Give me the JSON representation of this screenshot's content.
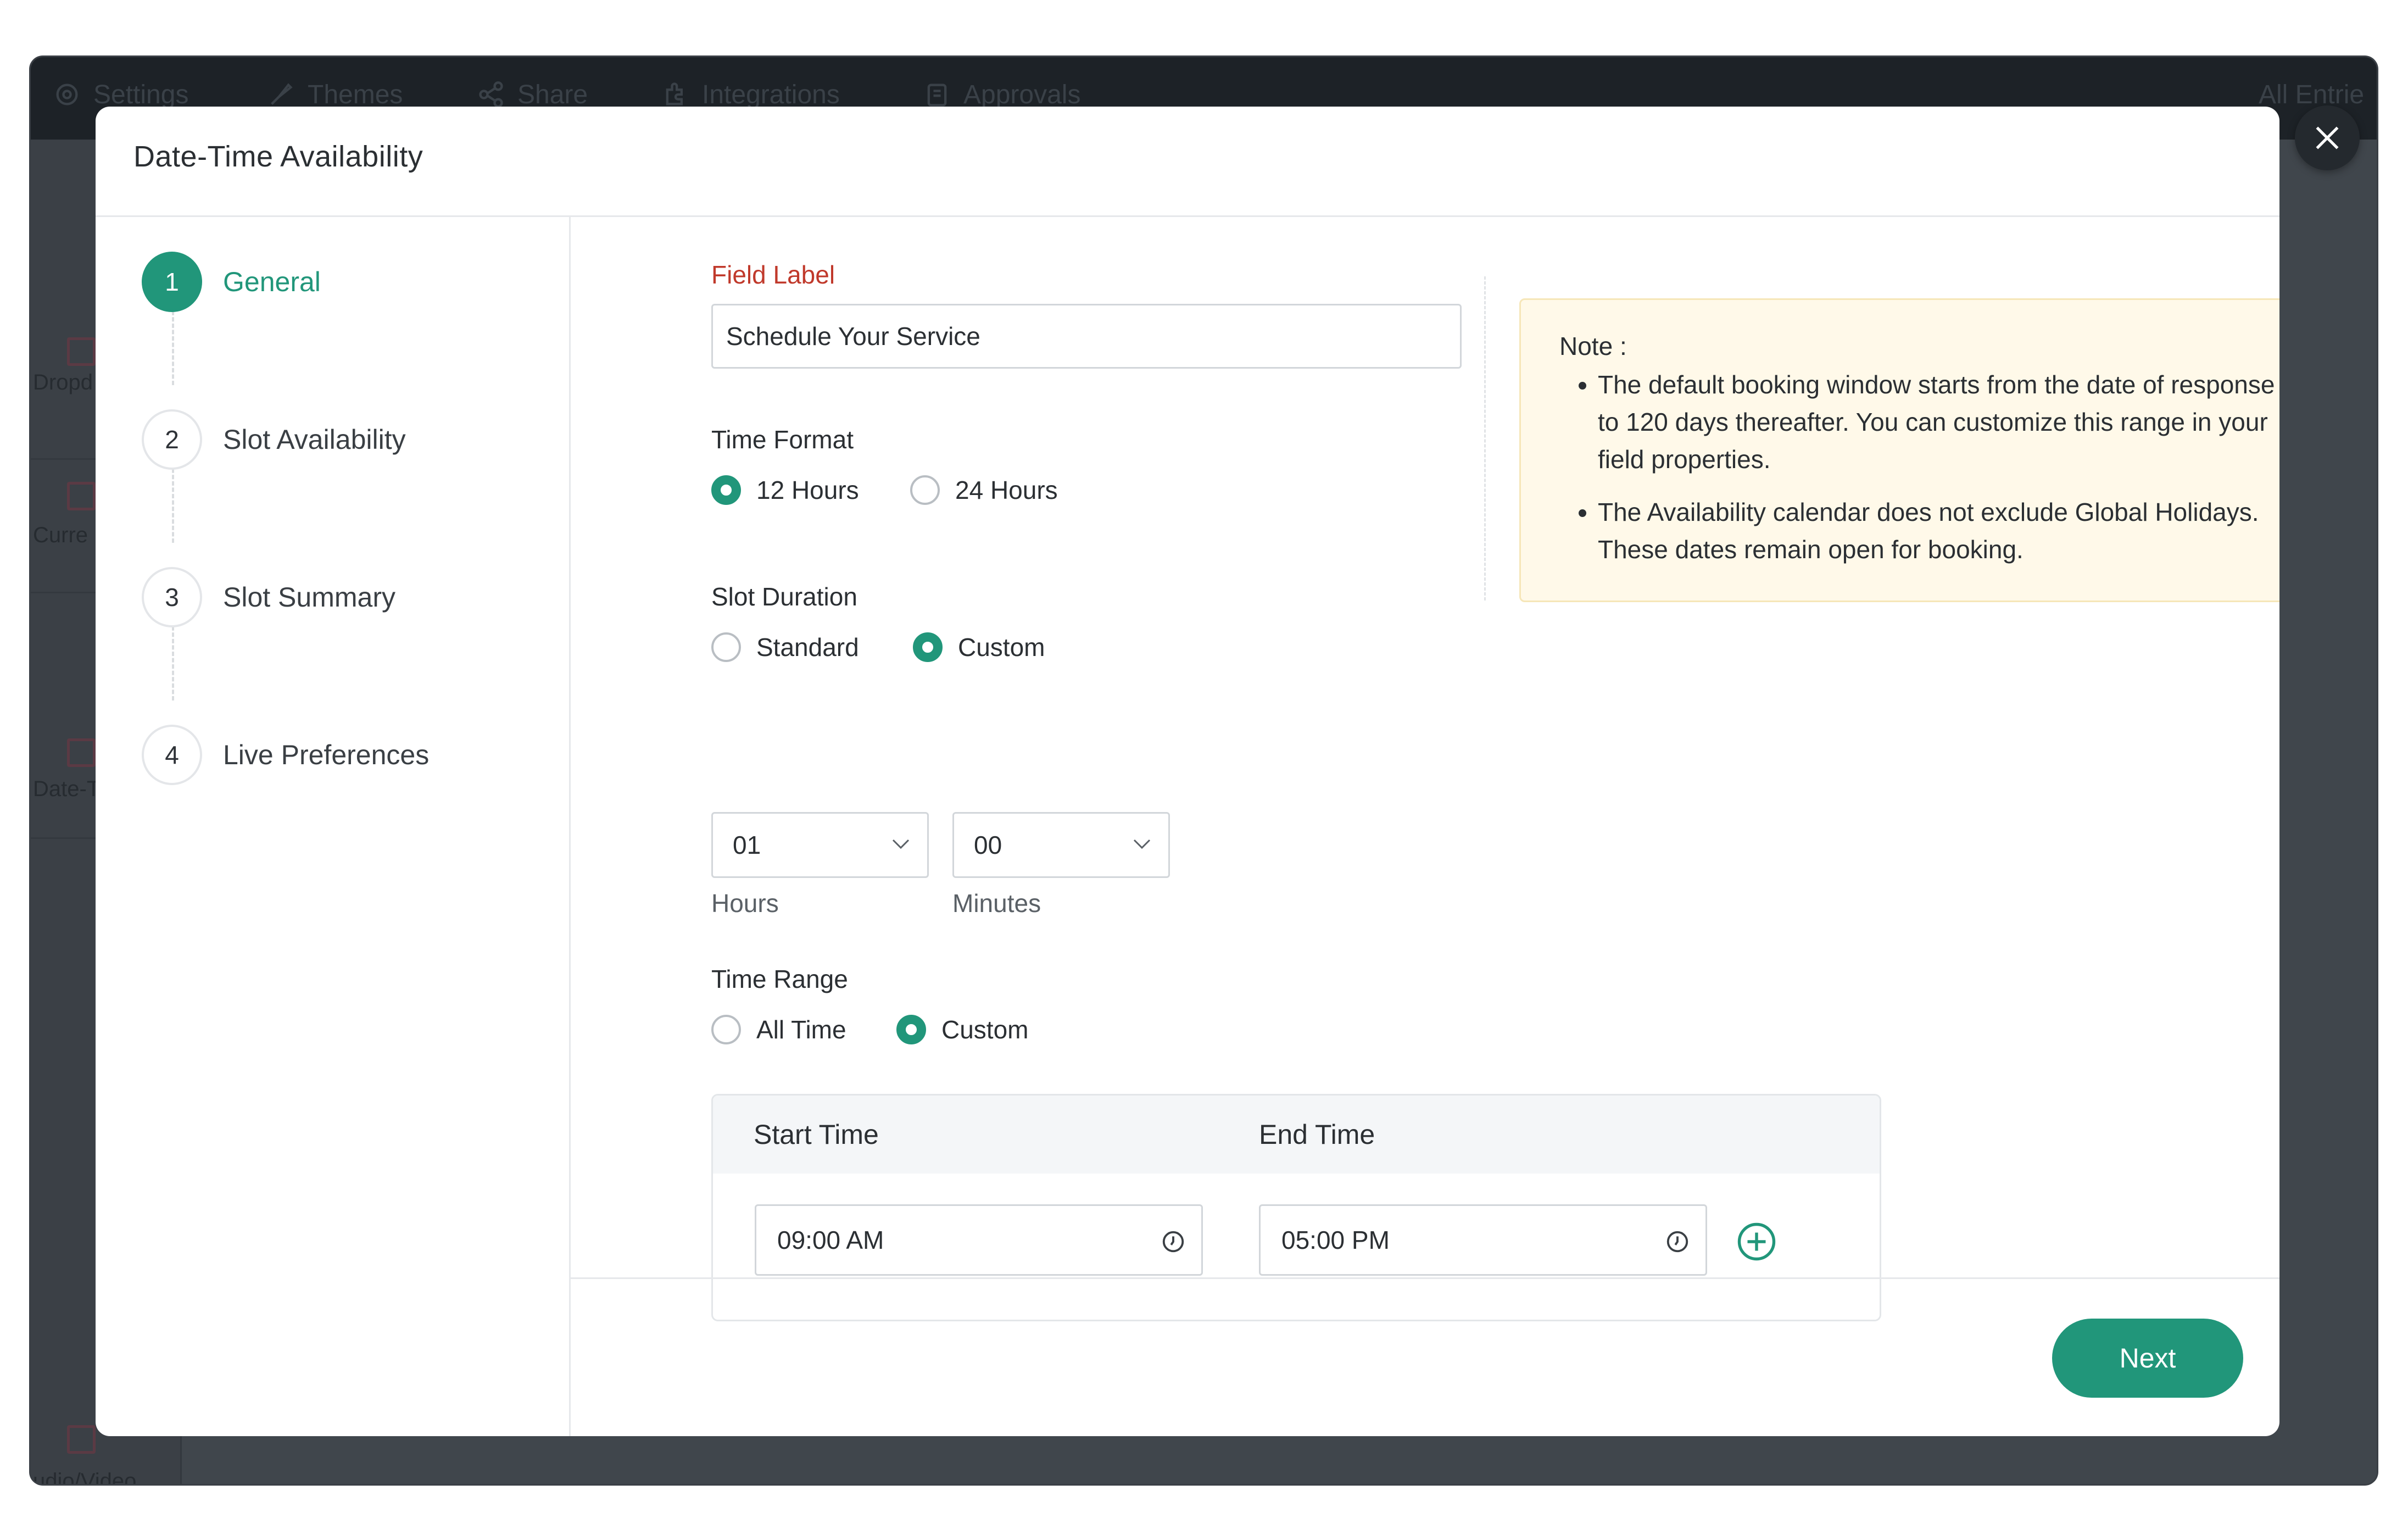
{
  "background": {
    "tabs": [
      {
        "label": "Settings",
        "icon": "gear-icon"
      },
      {
        "label": "Themes",
        "icon": "brush-icon"
      },
      {
        "label": "Share",
        "icon": "share-icon"
      },
      {
        "label": "Integrations",
        "icon": "puzzle-icon"
      },
      {
        "label": "Approvals",
        "icon": "clipboard-icon"
      }
    ],
    "right_label": "All Entrie",
    "sidebar_items": [
      "Dropd",
      "Curre",
      "Date-T",
      "udio/Video"
    ]
  },
  "modal": {
    "title": "Date-Time Availability",
    "close_icon": "close-icon"
  },
  "steps": [
    {
      "number": "1",
      "label": "General",
      "active": true
    },
    {
      "number": "2",
      "label": "Slot Availability",
      "active": false
    },
    {
      "number": "3",
      "label": "Slot Summary",
      "active": false
    },
    {
      "number": "4",
      "label": "Live Preferences",
      "active": false
    }
  ],
  "form": {
    "field_label": {
      "title": "Field Label",
      "value": "Schedule Your Service"
    },
    "time_format": {
      "label": "Time Format",
      "options": [
        "12 Hours",
        "24 Hours"
      ],
      "selected": "12 Hours"
    },
    "slot_duration": {
      "label": "Slot Duration",
      "options": [
        "Standard",
        "Custom"
      ],
      "selected": "Custom",
      "hours": {
        "value": "01",
        "label": "Hours"
      },
      "minutes": {
        "value": "00",
        "label": "Minutes"
      }
    },
    "time_range": {
      "label": "Time Range",
      "options": [
        "All Time",
        "Custom"
      ],
      "selected": "Custom",
      "start_header": "Start Time",
      "end_header": "End Time",
      "start_value": "09:00 AM",
      "end_value": "05:00 PM"
    }
  },
  "note": {
    "title": "Note :",
    "items": [
      "The default booking window starts from the date of response to 120 days thereafter. You can customize this range in your field properties.",
      "The Availability calendar does not exclude Global Holidays. These dates remain open for booking."
    ]
  },
  "footer": {
    "next_label": "Next"
  },
  "colors": {
    "accent": "#21967a",
    "required_label": "#c0392b",
    "note_bg": "#fff9e9",
    "overlay": "#4a4f55"
  }
}
